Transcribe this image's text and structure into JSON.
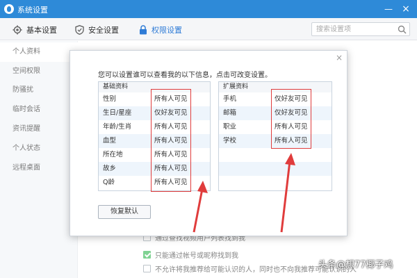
{
  "window": {
    "title": "系统设置"
  },
  "toolbar": {
    "basic_label": "基本设置",
    "security_label": "安全设置",
    "privacy_label": "权限设置",
    "search_placeholder": "搜索设置项"
  },
  "sidebar": {
    "items": [
      {
        "label": "个人资料"
      },
      {
        "label": "空间权限"
      },
      {
        "label": "防骚扰"
      },
      {
        "label": "临时会话"
      },
      {
        "label": "资讯提醒"
      },
      {
        "label": "个人状态"
      },
      {
        "label": "远程桌面"
      }
    ]
  },
  "background": {
    "options": [
      {
        "label": "通过查找视频用户列表找到我",
        "checked": false
      },
      {
        "label": "只能通过帐号或昵称找到我",
        "checked": true
      },
      {
        "label": "不允许将我推荐给可能认识的人，同时也不向我推荐可能认识的人",
        "checked": false
      }
    ]
  },
  "dialog": {
    "description": "您可以设置谁可以查看我的以下信息，点击可改变设置。",
    "close_symbol": "×",
    "basic_section": {
      "header": "基础资料",
      "rows": [
        {
          "label": "性别",
          "value": "所有人可见"
        },
        {
          "label": "生日/星座",
          "value": "仅好友可见"
        },
        {
          "label": "年龄/生肖",
          "value": "所有人可见"
        },
        {
          "label": "血型",
          "value": "所有人可见"
        },
        {
          "label": "所在地",
          "value": "所有人可见"
        },
        {
          "label": "故乡",
          "value": "所有人可见"
        },
        {
          "label": "Q龄",
          "value": "所有人可见"
        }
      ]
    },
    "extended_section": {
      "header": "扩展资料",
      "rows": [
        {
          "label": "手机",
          "value": "仅好友可见"
        },
        {
          "label": "邮箱",
          "value": "仅好友可见"
        },
        {
          "label": "职业",
          "value": "所有人可见"
        },
        {
          "label": "学校",
          "value": "所有人可见"
        }
      ]
    },
    "restore_label": "恢复默认"
  },
  "watermark": "头条@想77椰子鸡",
  "colors": {
    "titlebar": "#2e8ad8",
    "accent": "#2e7bd6",
    "highlight": "#e03c3c"
  }
}
